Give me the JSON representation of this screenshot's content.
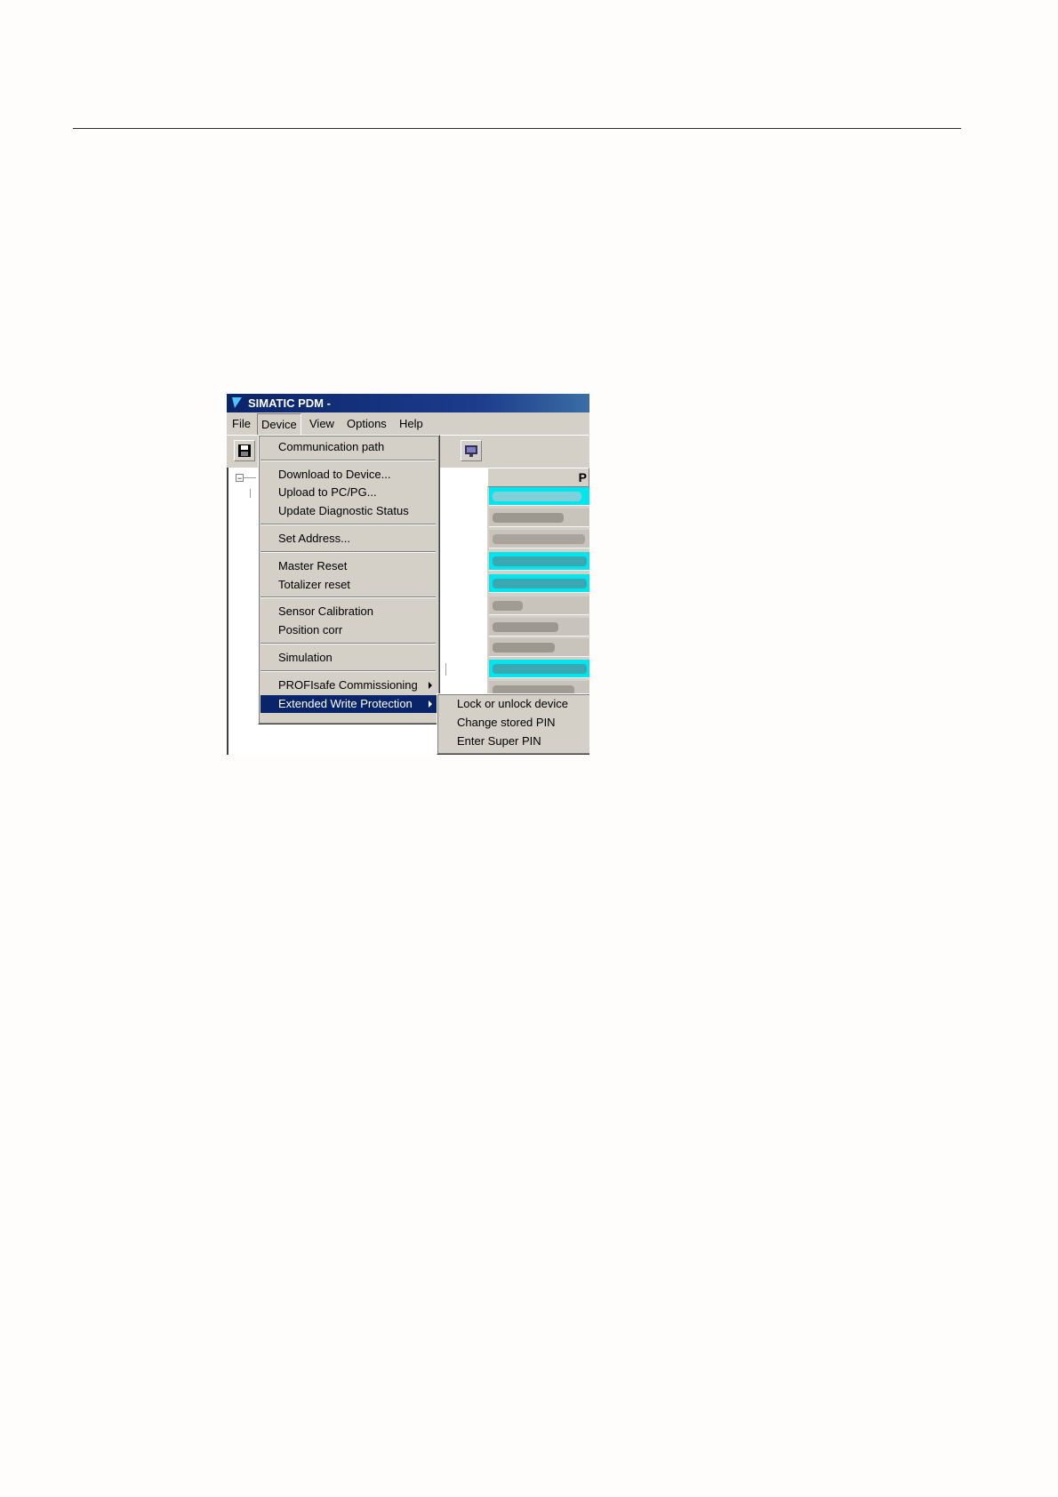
{
  "window": {
    "title": "SIMATIC PDM -"
  },
  "menubar": {
    "items": [
      {
        "label": "File"
      },
      {
        "label": "Device"
      },
      {
        "label": "View"
      },
      {
        "label": "Options"
      },
      {
        "label": "Help"
      }
    ]
  },
  "device_menu": {
    "items": [
      {
        "label": "Communication path"
      },
      {
        "label": "Download to Device..."
      },
      {
        "label": "Upload to PC/PG..."
      },
      {
        "label": "Update Diagnostic Status"
      },
      {
        "label": "Set Address..."
      },
      {
        "label": "Master Reset"
      },
      {
        "label": "Totalizer reset"
      },
      {
        "label": "Sensor Calibration"
      },
      {
        "label": "Position corr"
      },
      {
        "label": "Simulation"
      },
      {
        "label": "PROFIsafe Commissioning"
      },
      {
        "label": "Extended Write Protection"
      }
    ]
  },
  "submenu": {
    "items": [
      {
        "label": "Lock or unlock device"
      },
      {
        "label": "Change stored PIN"
      },
      {
        "label": "Enter Super PIN"
      }
    ]
  },
  "right_pane": {
    "header": "P"
  },
  "colors": {
    "selection": "#0a246a",
    "highlight_row": "#00e5ee",
    "menu_bg": "#d4d0c8"
  },
  "icons": [
    "app-icon",
    "save-icon",
    "toolbar-icon",
    "tree-expander-icon",
    "submenu-arrow-icon"
  ]
}
